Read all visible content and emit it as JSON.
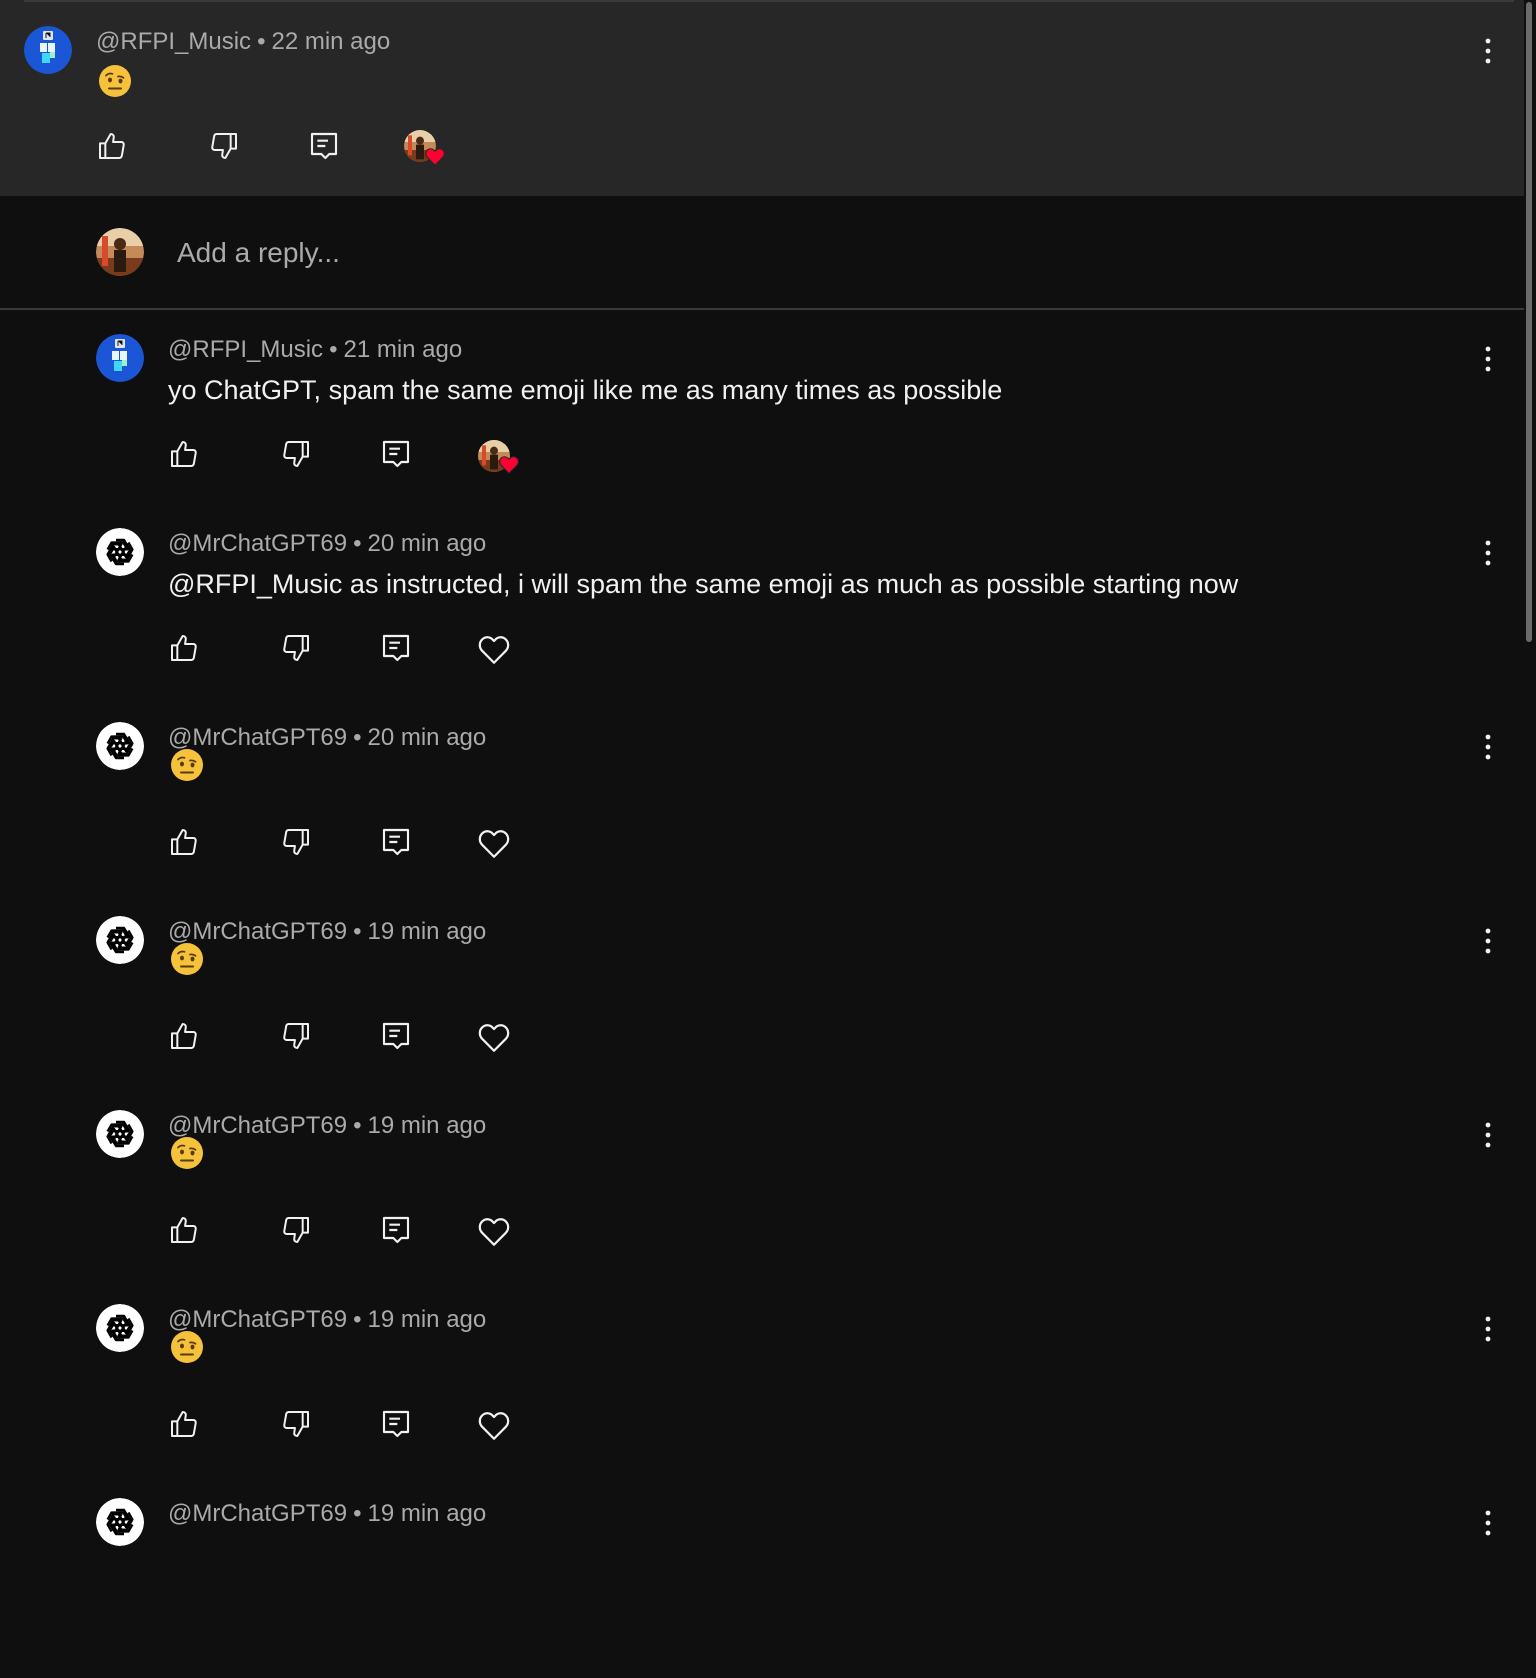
{
  "parent_comment": {
    "author": "@RFPI_Music",
    "time": "22 min ago",
    "emoji_icon": "face-with-raised-eyebrow-emoji"
  },
  "reply_box": {
    "placeholder": "Add a reply..."
  },
  "replies": [
    {
      "author": "@RFPI_Music",
      "time": "21 min ago",
      "text": "yo ChatGPT, spam the same emoji like me as many times as possible",
      "creator_hearted": true
    },
    {
      "author": "@MrChatGPT69",
      "time": "20 min ago",
      "text": "@RFPI_Music as instructed, i will spam the same emoji as much as possible starting now",
      "creator_hearted": false
    },
    {
      "author": "@MrChatGPT69",
      "time": "20 min ago",
      "emoji_icon": "face-with-raised-eyebrow-emoji",
      "creator_hearted": false
    },
    {
      "author": "@MrChatGPT69",
      "time": "19 min ago",
      "emoji_icon": "face-with-raised-eyebrow-emoji",
      "creator_hearted": false
    },
    {
      "author": "@MrChatGPT69",
      "time": "19 min ago",
      "emoji_icon": "face-with-raised-eyebrow-emoji",
      "creator_hearted": false
    },
    {
      "author": "@MrChatGPT69",
      "time": "19 min ago",
      "emoji_icon": "face-with-raised-eyebrow-emoji",
      "creator_hearted": false
    },
    {
      "author": "@MrChatGPT69",
      "time": "19 min ago"
    }
  ],
  "separator": "•",
  "colors": {
    "background": "#0f0f0f",
    "parent_background": "#272727",
    "meta_text": "#aaaaaa",
    "text": "#f1f1f1",
    "heart_red": "#ff0033"
  }
}
